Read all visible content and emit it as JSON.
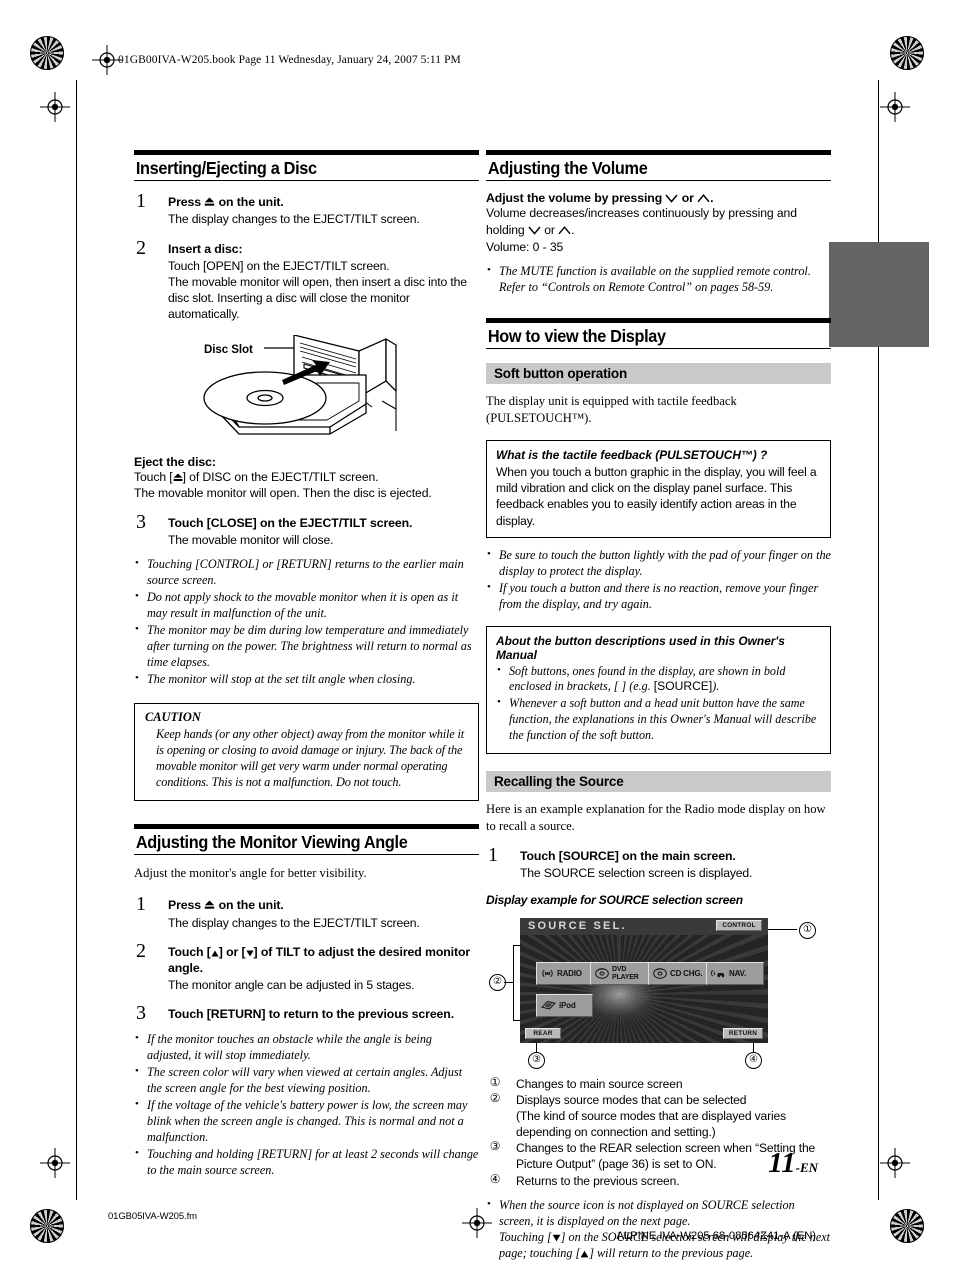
{
  "header": {
    "slug": "01GB00IVA-W205.book  Page 11  Wednesday, January 24, 2007  5:11 PM"
  },
  "left_column": {
    "section1": {
      "title": "Inserting/Ejecting a Disc",
      "steps": [
        {
          "num": "1",
          "heading_pre": "Press ",
          "heading_icon": "eject-icon",
          "heading_post": " on the unit.",
          "body": "The display changes to the EJECT/TILT screen."
        },
        {
          "num": "2",
          "heading": "Insert a disc:",
          "body": "Touch [OPEN] on the EJECT/TILT screen.\nThe movable monitor will open, then insert a disc into the disc slot. Inserting a disc will close the monitor automatically."
        }
      ],
      "figure": {
        "label": "Disc Slot",
        "alt": "disc-slot-illustration"
      },
      "eject_heading": "Eject the disc:",
      "eject_body_1_pre": "Touch [",
      "eject_body_1_post": "] of DISC on the EJECT/TILT screen.",
      "eject_body_2": "The movable monitor will open. Then the disc is ejected.",
      "step3": {
        "num": "3",
        "heading_pre": "Touch ",
        "heading_bracket": "[CLOSE]",
        "heading_post": " on the EJECT/TILT screen.",
        "body": "The movable monitor will close."
      },
      "notes": [
        "Touching [CONTROL] or [RETURN] returns to the earlier main source screen.",
        "Do not apply shock to the movable monitor when it is open as it may result in malfunction of the unit.",
        "The monitor may be dim during low temperature and immediately after turning on the power. The brightness will return to normal as time elapses.",
        "The monitor will stop at the set tilt angle when closing."
      ],
      "caution": {
        "title": "CAUTION",
        "text": "Keep hands (or any other object) away from the monitor while it is opening or closing to avoid damage or injury. The back of the movable monitor will get very warm under normal operating conditions. This is not a malfunction. Do not touch."
      }
    },
    "section2": {
      "title": "Adjusting the Monitor Viewing Angle",
      "intro": "Adjust the monitor's angle for better visibility.",
      "steps": [
        {
          "num": "1",
          "heading_pre": "Press ",
          "heading_icon": "eject-icon",
          "heading_post": " on the unit.",
          "body": "The display changes to the EJECT/TILT screen."
        },
        {
          "num": "2",
          "heading_pre": "Touch [",
          "heading_mid": "] or [",
          "heading_post": "] of TILT to adjust the desired monitor angle.",
          "body": "The monitor angle can be adjusted in 5 stages."
        },
        {
          "num": "3",
          "heading_pre": "Touch ",
          "heading_bracket": "[RETURN]",
          "heading_post": " to return to the previous screen."
        }
      ],
      "notes": [
        "If the monitor touches an obstacle while the angle is being adjusted, it will stop immediately.",
        "The screen color will vary when viewed at certain angles. Adjust the screen angle for the best viewing position.",
        "If the voltage of the vehicle's battery power is low, the screen may blink when the screen angle is changed. This is normal and not a malfunction.",
        "Touching and holding [RETURN] for at least 2 seconds will change to the main source screen."
      ]
    }
  },
  "right_column": {
    "section1": {
      "title": "Adjusting the Volume",
      "lead_pre": "Adjust the volume by pressing ",
      "lead_mid": " or ",
      "lead_post": ".",
      "body_1": "Volume decreases/increases continuously by pressing and holding ",
      "body_1_mid": " or ",
      "body_1_post": ".",
      "body_2": "Volume: 0 - 35",
      "notes": [
        "The MUTE function is available on the supplied remote control. Refer to “Controls on Remote Control” on pages 58-59."
      ]
    },
    "section2": {
      "title": "How to view the Display",
      "subhead_1": "Soft button operation",
      "intro": "The display unit is equipped with tactile feedback (PULSETOUCH™).",
      "box_1": {
        "title": "What is the tactile feedback (PULSETOUCH™) ?",
        "text": "When you touch a button graphic in the display, you will feel a mild vibration and click on the display panel surface. This feedback enables you to easily identify action areas in the display."
      },
      "notes": [
        "Be sure to touch the button lightly with the pad of your finger on the display to protect the display.",
        "If you touch a button and there is no reaction, remove your finger from the display, and try again."
      ],
      "box_2": {
        "title": "About the button descriptions used in this Owner's Manual",
        "bullets_pre": "Soft buttons, ones found in the display, are shown in bold enclosed in brackets, [ ] (e.g. ",
        "bullets_bracket": "[SOURCE]",
        "bullets_post": ").",
        "bullet_2": "Whenever a soft button and a head unit button have the same function, the explanations in this Owner's Manual will describe the function of the soft button."
      },
      "subhead_2": "Recalling the Source",
      "intro_2": "Here is an example explanation for the Radio mode display on how to recall a source.",
      "step": {
        "num": "1",
        "heading_pre": "Touch ",
        "heading_bracket": "[SOURCE]",
        "heading_post": " on the main screen.",
        "body": "The SOURCE selection screen is displayed."
      },
      "figure_caption": "Display example for SOURCE selection screen",
      "screen": {
        "title": "SOURCE SEL.",
        "control_button": "CONTROL",
        "rear_button": "REAR",
        "return_button": "RETURN",
        "sources": [
          {
            "label": "RADIO",
            "icon": "radio-wave-icon"
          },
          {
            "label": "DVD\nPLAYER",
            "icon": "disc-icon"
          },
          {
            "label": "CD CHG.",
            "icon": "disc-icon"
          },
          {
            "label": "NAV.",
            "icon": "navigation-car-icon"
          },
          {
            "label": "iPod",
            "icon": "ipod-icon"
          }
        ],
        "callouts": [
          "1",
          "2",
          "3",
          "4"
        ]
      },
      "captions": [
        {
          "n": "①",
          "text": "Changes to main source screen"
        },
        {
          "n": "②",
          "text": "Displays source modes that can be selected\n(The kind of source modes that are displayed varies depending on connection and setting.)"
        },
        {
          "n": "③",
          "text": "Changes to the REAR selection screen when “Setting the Picture Output” (page 36) is set to ON."
        },
        {
          "n": "④",
          "text": "Returns to the previous screen."
        }
      ],
      "final_note_1": "When the source icon is not displayed on SOURCE selection screen, it is displayed on the next page.",
      "final_note_2_pre": "Touching [",
      "final_note_2_mid": "] on the SOURCE selection screen will display the next page; touching [",
      "final_note_2_post": "] will return to the previous page."
    }
  },
  "footer": {
    "page_number": "11",
    "page_suffix": "-EN",
    "file_name": "01GB05IVA-W205.fm",
    "doc_id": "ALPINE IVA-W205 68-08564Z41-A (EN)"
  },
  "colors": {
    "subhead_bg": "#c9c9c9",
    "thumb_tab": "#646464",
    "rule": "#000000"
  }
}
